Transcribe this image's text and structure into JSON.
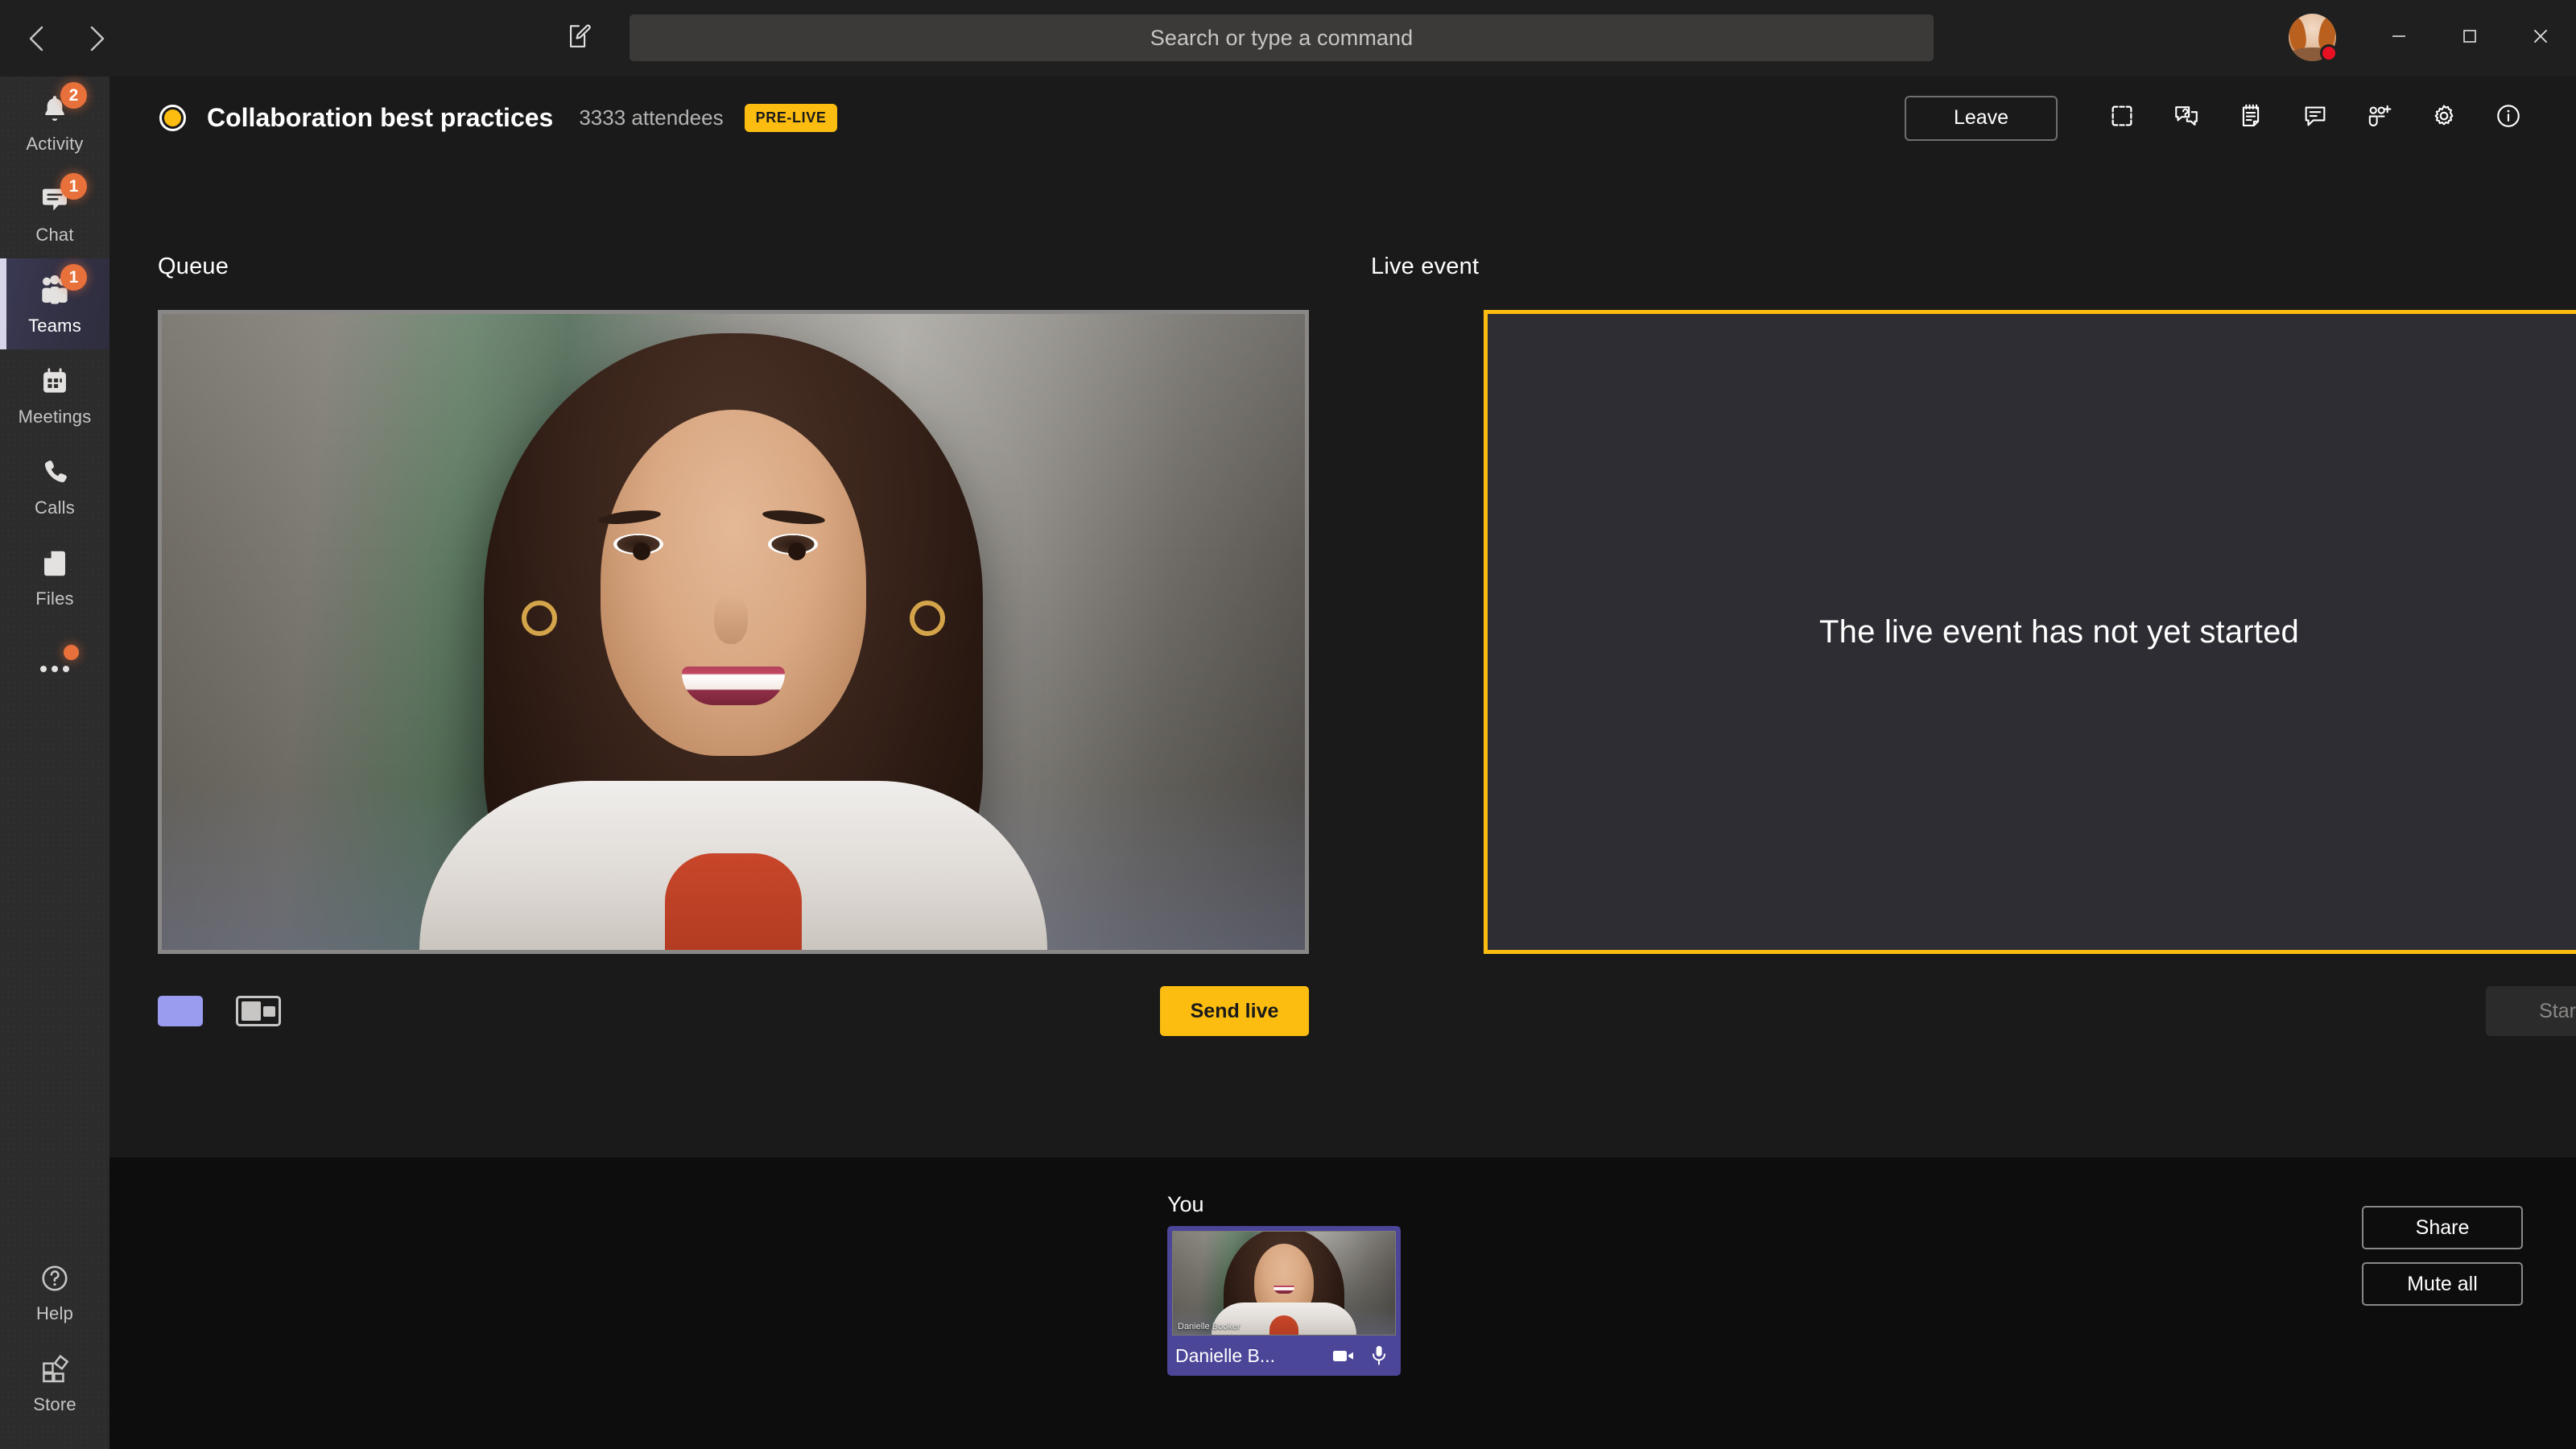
{
  "titlebar": {
    "back_icon": "chevron-left-icon",
    "forward_icon": "chevron-right-icon",
    "compose_icon": "compose-icon",
    "search_placeholder": "Search or type a command",
    "avatar_name": "avatar",
    "presence": "busy",
    "presence_color": "#e81123",
    "minimize_label": "minimize",
    "maximize_label": "maximize",
    "close_label": "close"
  },
  "rail": {
    "items": [
      {
        "label": "Activity",
        "icon": "bell-icon",
        "badge": "2",
        "active": false
      },
      {
        "label": "Chat",
        "icon": "chat-icon",
        "badge": "1",
        "active": false
      },
      {
        "label": "Teams",
        "icon": "teams-icon",
        "badge": "1",
        "active": true
      },
      {
        "label": "Meetings",
        "icon": "calendar-icon",
        "badge": "",
        "active": false
      },
      {
        "label": "Calls",
        "icon": "phone-icon",
        "badge": "",
        "active": false
      },
      {
        "label": "Files",
        "icon": "file-icon",
        "badge": "",
        "active": false
      }
    ],
    "more": {
      "label": "more-options",
      "icon": "ellipsis-icon",
      "dot": true
    },
    "bottom": [
      {
        "label": "Help",
        "icon": "help-icon"
      },
      {
        "label": "Store",
        "icon": "store-icon"
      }
    ]
  },
  "event": {
    "recording_icon": "record-indicator-icon",
    "title": "Collaboration best practices",
    "attendees": "3333 attendees",
    "status_badge": "PRE-LIVE",
    "status_color": "#fdbd10",
    "leave_label": "Leave",
    "actions": [
      {
        "icon": "fullscreen-icon",
        "name": "fullscreen-button"
      },
      {
        "icon": "qna-icon",
        "name": "qna-button"
      },
      {
        "icon": "notes-icon",
        "name": "notes-button"
      },
      {
        "icon": "chat-bubble-icon",
        "name": "chat-button"
      },
      {
        "icon": "add-people-icon",
        "name": "add-people-button"
      },
      {
        "icon": "gear-icon",
        "name": "settings-button"
      },
      {
        "icon": "info-icon",
        "name": "info-button"
      }
    ]
  },
  "queue": {
    "label": "Queue",
    "layout_solid_color": "#9a9cf0",
    "send_live_label": "Send live"
  },
  "live": {
    "label": "Live event",
    "placeholder": "The live event has not yet started",
    "border_color": "#fdbd10",
    "start_label": "Start"
  },
  "bottom": {
    "you_label": "You",
    "self_name": "Danielle B...",
    "self_video_caption": "Danielle Booker",
    "camera_icon": "camera-icon",
    "mic_icon": "microphone-icon",
    "share_label": "Share",
    "mute_all_label": "Mute all"
  }
}
